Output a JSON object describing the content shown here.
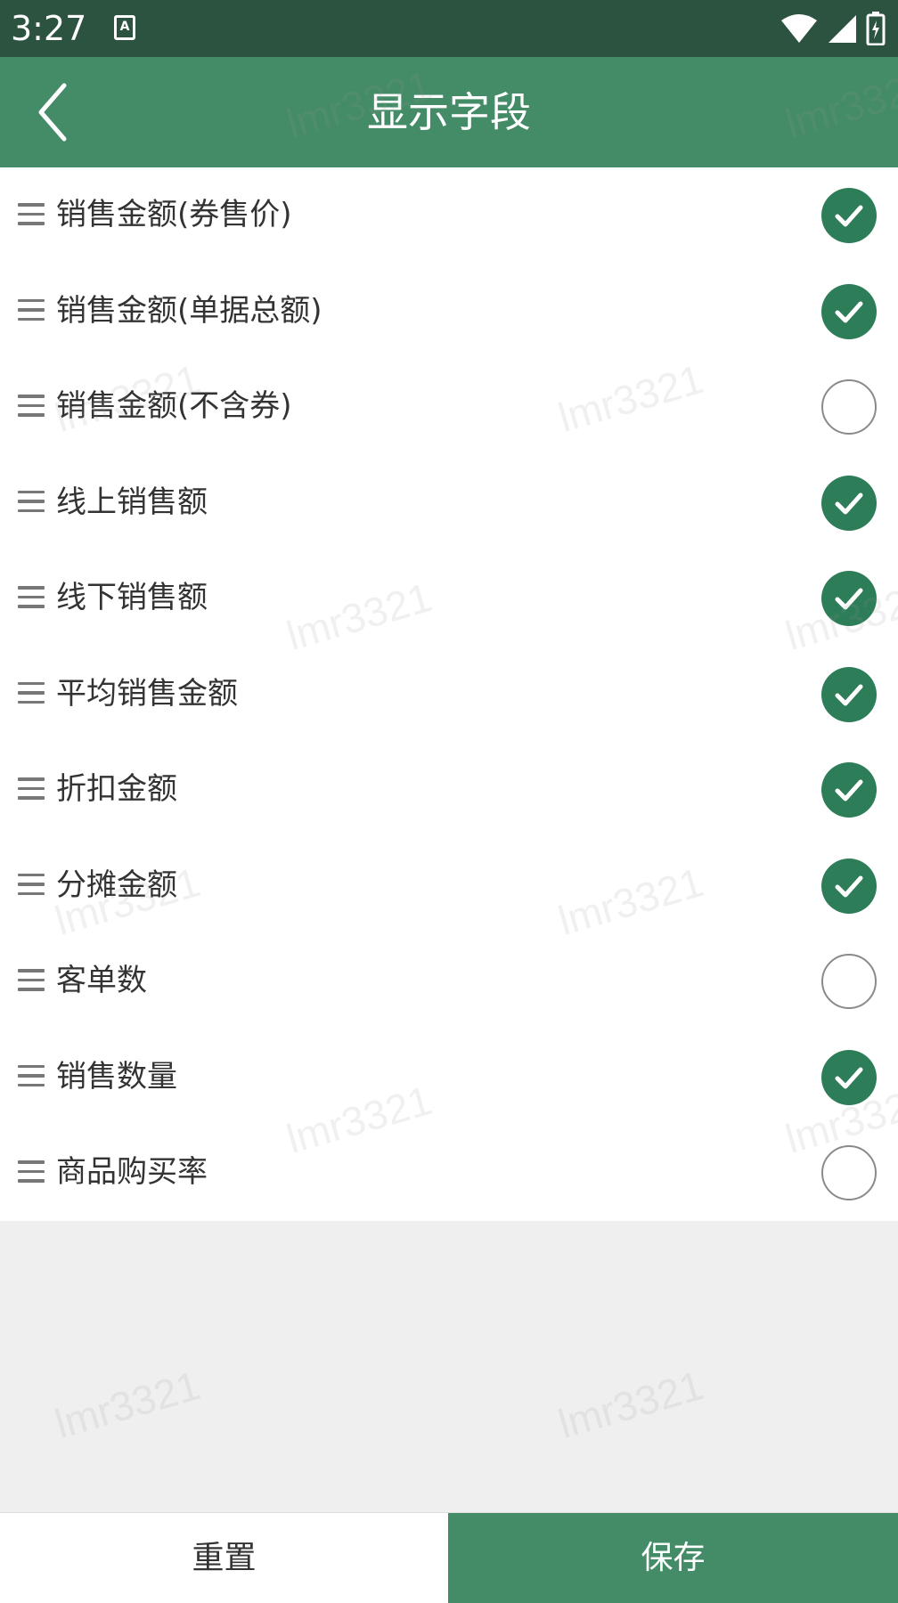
{
  "status_bar": {
    "time": "3:27",
    "notification_icon": "a-box-icon",
    "icons": [
      "wifi-icon",
      "signal-icon",
      "battery-icon"
    ]
  },
  "app_bar": {
    "title": "显示字段",
    "back_icon": "chevron-left-icon"
  },
  "fields": [
    {
      "label": "销售金额(券售价)",
      "checked": true
    },
    {
      "label": "销售金额(单据总额)",
      "checked": true
    },
    {
      "label": "销售金额(不含券)",
      "checked": false
    },
    {
      "label": "线上销售额",
      "checked": true
    },
    {
      "label": "线下销售额",
      "checked": true
    },
    {
      "label": "平均销售金额",
      "checked": true
    },
    {
      "label": "折扣金额",
      "checked": true
    },
    {
      "label": "分摊金额",
      "checked": true
    },
    {
      "label": "客单数",
      "checked": false
    },
    {
      "label": "销售数量",
      "checked": true
    },
    {
      "label": "商品购买率",
      "checked": false
    }
  ],
  "watermark": "lmr3321",
  "footer": {
    "reset_label": "重置",
    "save_label": "保存"
  },
  "colors": {
    "status_bar": "#2c5240",
    "app_bar": "#448c68",
    "check_on": "#2e7d59"
  }
}
